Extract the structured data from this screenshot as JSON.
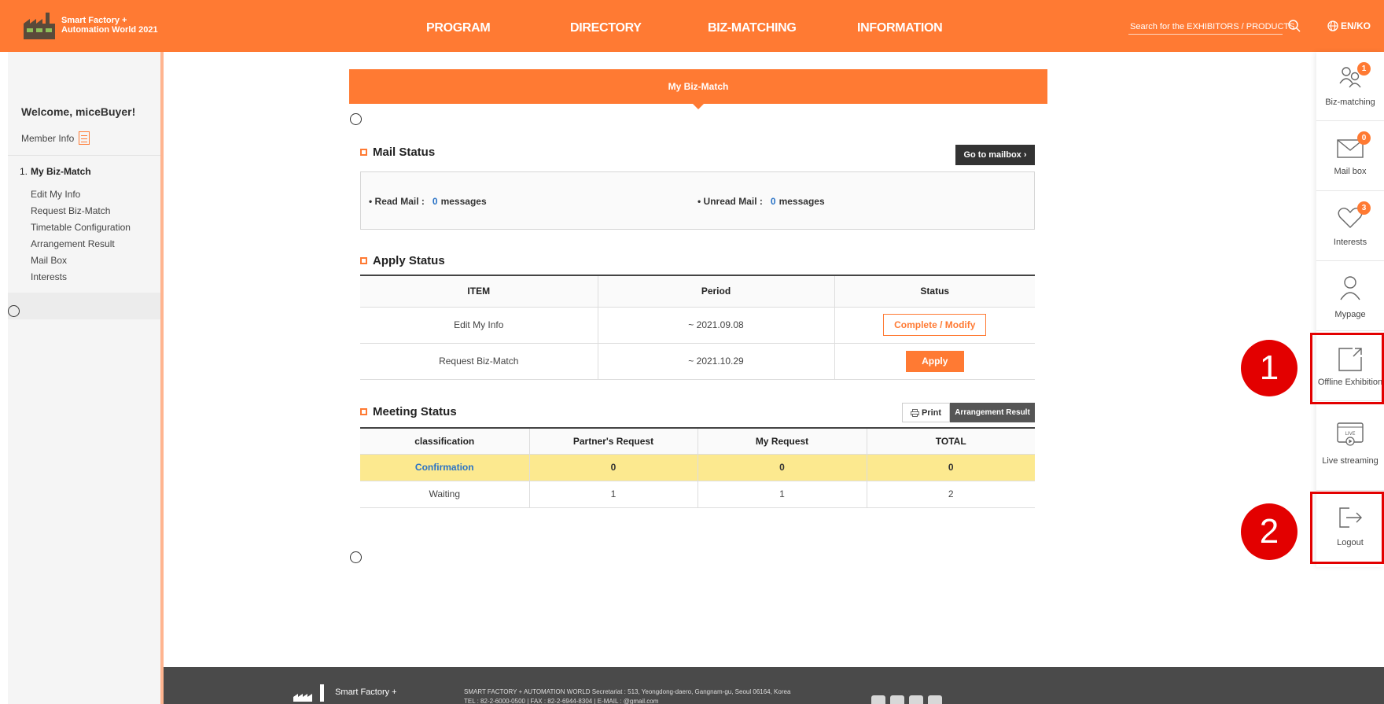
{
  "header": {
    "logo_line1": "Smart Factory +",
    "logo_line2": "Automation World 2021",
    "nav": [
      "PROGRAM",
      "DIRECTORY",
      "BIZ-MATCHING",
      "INFORMATION"
    ],
    "search_placeholder": "Search for the EXHIBITORS / PRODUCTS",
    "lang": "EN/KO"
  },
  "sidebar": {
    "welcome": "Welcome, miceBuyer!",
    "member_info": "Member Info",
    "section_num": "1.",
    "section_title": "My Biz-Match",
    "links": [
      "Edit My Info",
      "Request Biz-Match",
      "Timetable Configuration",
      "Arrangement Result",
      "Mail Box",
      "Interests"
    ]
  },
  "main": {
    "tab_title": "My Biz-Match",
    "mail_status": {
      "title": "Mail Status",
      "goto_button": "Go to mailbox",
      "read_label": "• Read Mail :",
      "read_count": "0",
      "unread_label": "• Unread Mail :",
      "unread_count": "0",
      "unit": "messages"
    },
    "apply_status": {
      "title": "Apply Status",
      "headers": [
        "ITEM",
        "Period",
        "Status"
      ],
      "rows": [
        {
          "item": "Edit My Info",
          "period": "~ 2021.09.08",
          "action": "Complete / Modify"
        },
        {
          "item": "Request Biz-Match",
          "period": "~ 2021.10.29",
          "action": "Apply"
        }
      ]
    },
    "meeting_status": {
      "title": "Meeting Status",
      "print_button": "Print",
      "arrangement_button": "Arrangement Result",
      "headers": [
        "classification",
        "Partner's Request",
        "My Request",
        "TOTAL"
      ],
      "rows": [
        [
          "Confirmation",
          "0",
          "0",
          "0"
        ],
        [
          "Waiting",
          "1",
          "1",
          "2"
        ]
      ]
    }
  },
  "rail": {
    "items": [
      {
        "label": "Biz-matching",
        "badge": "1",
        "icon": "people-icon"
      },
      {
        "label": "Mail box",
        "badge": "0",
        "icon": "mail-icon"
      },
      {
        "label": "Interests",
        "badge": "3",
        "icon": "heart-icon"
      },
      {
        "label": "Mypage",
        "badge": "",
        "icon": "user-icon"
      },
      {
        "label": "Offline Exhibition",
        "badge": "",
        "icon": "external-link-icon"
      },
      {
        "label": "Live streaming",
        "badge": "",
        "icon": "live-icon"
      },
      {
        "label": "Logout",
        "badge": "",
        "icon": "logout-icon"
      }
    ],
    "annotations": [
      "1",
      "2"
    ]
  },
  "footer": {
    "logo_text": "Smart Factory +",
    "address": "SMART FACTORY + AUTOMATION WORLD Secretariat : 513, Yeongdong-daero, Gangnam-gu, Seoul 06164, Korea",
    "contact": "TEL : 82-2-6000-0500 | FAX : 82-2-6944-8304 | E-MAIL : @gmail.com"
  },
  "colors": {
    "brand": "#ff7a33",
    "annotation": "#e30000",
    "link": "#2a73c6",
    "highlight": "#fce98f"
  }
}
